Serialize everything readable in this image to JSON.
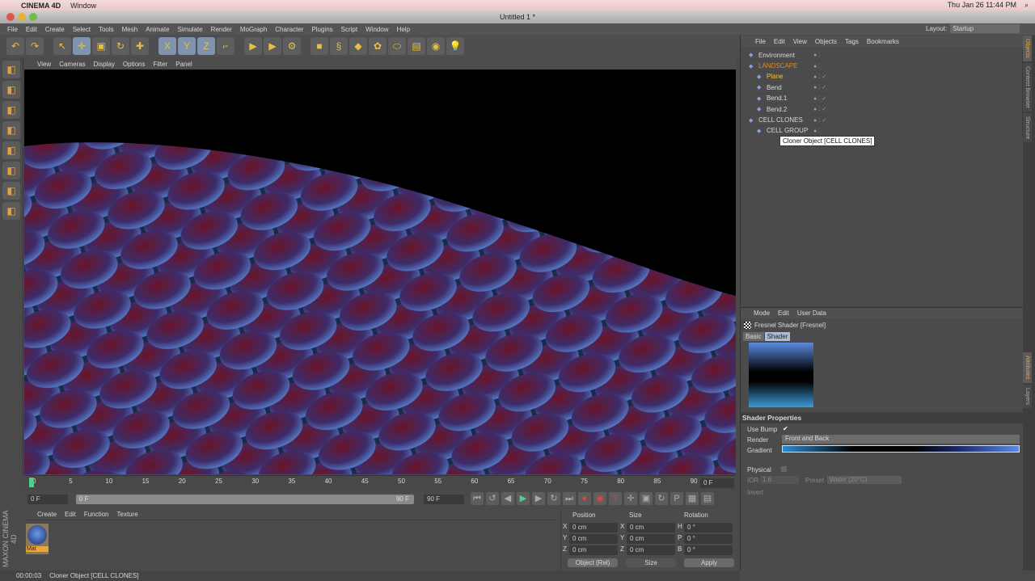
{
  "mac": {
    "app": "CINEMA 4D",
    "menu": "Window",
    "clock": "Thu Jan 26  11:44 PM"
  },
  "window": {
    "title": "Untitled 1 *"
  },
  "menu": [
    "File",
    "Edit",
    "Create",
    "Select",
    "Tools",
    "Mesh",
    "Animate",
    "Simulate",
    "Render",
    "MoGraph",
    "Character",
    "Plugins",
    "Script",
    "Window",
    "Help"
  ],
  "layout": {
    "label": "Layout:",
    "value": "Startup"
  },
  "toolbar": [
    [
      "undo-icon",
      "↶",
      0
    ],
    [
      "redo-icon",
      "↷",
      0
    ],
    [
      "gap"
    ],
    [
      "live-selection-icon",
      "↖",
      0
    ],
    [
      "move-icon",
      "✛",
      1
    ],
    [
      "scale-icon",
      "▣",
      0
    ],
    [
      "rotate-icon",
      "↻",
      0
    ],
    [
      "add-icon",
      "✚",
      0
    ],
    [
      "gap"
    ],
    [
      "x-axis-icon",
      "X",
      1
    ],
    [
      "y-axis-icon",
      "Y",
      1
    ],
    [
      "z-axis-icon",
      "Z",
      1
    ],
    [
      "coordinate-system-icon",
      "⌐",
      0
    ],
    [
      "gap"
    ],
    [
      "render-view-icon",
      "▶",
      0
    ],
    [
      "render-picture-viewer-icon",
      "▶",
      0
    ],
    [
      "render-settings-icon",
      "⚙",
      0
    ],
    [
      "gap"
    ],
    [
      "cube-icon",
      "■",
      0
    ],
    [
      "spline-icon",
      "§",
      0
    ],
    [
      "nurbs-icon",
      "◆",
      0
    ],
    [
      "array-icon",
      "✿",
      0
    ],
    [
      "deformer-icon",
      "⬭",
      0
    ],
    [
      "environment-icon",
      "▤",
      0
    ],
    [
      "camera-icon",
      "◉",
      0
    ],
    [
      "light-icon",
      "💡",
      0
    ]
  ],
  "viewport_menu": [
    "View",
    "Cameras",
    "Display",
    "Options",
    "Filter",
    "Panel"
  ],
  "left_tools": [
    "make-editable-icon",
    "model-icon",
    "texture-icon",
    "object-mode-icon",
    "point-mode-icon",
    "polygon-mode-icon",
    "axis-icon",
    "magnet-icon"
  ],
  "timeline": {
    "ticks": [
      "0",
      "5",
      "10",
      "15",
      "20",
      "25",
      "30",
      "35",
      "40",
      "45",
      "50",
      "55",
      "60",
      "65",
      "70",
      "75",
      "80",
      "85",
      "90"
    ],
    "current": "0 F",
    "start": "0 F",
    "range_start": "0 F",
    "range_end": "90 F",
    "end": "90 F"
  },
  "material": {
    "menu": [
      "Create",
      "Edit",
      "Function",
      "Texture"
    ],
    "name": "Mat"
  },
  "coords": {
    "headers": [
      "Position",
      "Size",
      "Rotation"
    ],
    "rows": [
      [
        "X",
        "0 cm",
        "X",
        "0 cm",
        "H",
        "0 °"
      ],
      [
        "Y",
        "0 cm",
        "Y",
        "0 cm",
        "P",
        "0 °"
      ],
      [
        "Z",
        "0 cm",
        "Z",
        "0 cm",
        "B",
        "0 °"
      ]
    ],
    "mode": "Object (Rel)",
    "size_mode": "Size",
    "apply": "Apply"
  },
  "status": {
    "time": "00:00:03",
    "text": "Cloner Object [CELL CLONES]"
  },
  "objects": {
    "menu": [
      "File",
      "Edit",
      "View",
      "Objects",
      "Tags",
      "Bookmarks"
    ],
    "items": [
      {
        "name": "Environment",
        "indent": 0,
        "color": "#d8d8d8"
      },
      {
        "name": "LANDSCAPE",
        "indent": 0,
        "color": "#d9892e"
      },
      {
        "name": "Plane",
        "indent": 1,
        "color": "#f0c040"
      },
      {
        "name": "Bend",
        "indent": 1,
        "color": "#d8d8d8"
      },
      {
        "name": "Bend.1",
        "indent": 1,
        "color": "#d8d8d8"
      },
      {
        "name": "Bend.2",
        "indent": 1,
        "color": "#d8d8d8"
      },
      {
        "name": "CELL CLONES",
        "indent": 0,
        "color": "#d8d8d8"
      },
      {
        "name": "CELL GROUP",
        "indent": 1,
        "color": "#d8d8d8"
      }
    ],
    "tooltip": "Cloner Object [CELL CLONES]"
  },
  "attributes": {
    "menu": [
      "Mode",
      "Edit",
      "User Data"
    ],
    "title": "Fresnel Shader [Fresnel]",
    "tabs": [
      "Basic",
      "Shader"
    ],
    "section": "Shader Properties",
    "use_bump": "Use Bump",
    "render_label": "Render",
    "render_value": "Front and Back",
    "gradient": "Gradient",
    "physical": "Physical",
    "ior_label": "IOR",
    "ior": "1.6",
    "preset_label": "Preset",
    "preset": "Water (20°C)",
    "invert": "Invert"
  },
  "side_tabs": [
    "Objects",
    "Content Browser",
    "Structure",
    "Attributes",
    "Layers"
  ]
}
